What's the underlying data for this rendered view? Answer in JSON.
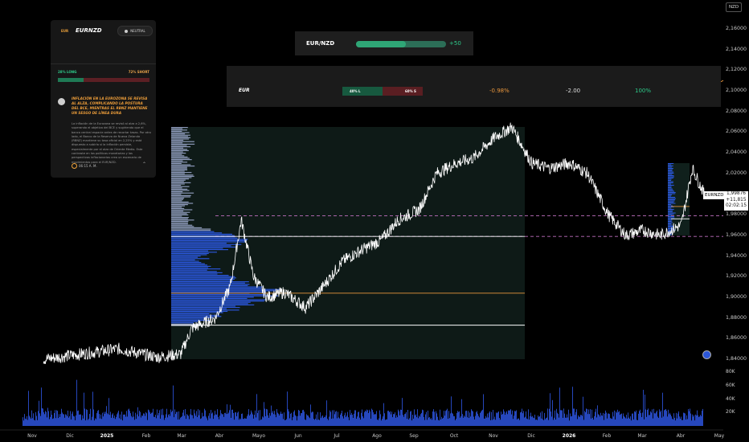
{
  "card": {
    "small_symbol": "EUR",
    "pair": "EURNZD",
    "sentiment": "NEUTRAL",
    "long_label": "28% LONG",
    "short_label": "72% SHORT",
    "long_fraction": 0.28,
    "headline": "INFLACIÓN EN LA EUROZONA SE REVISA AL ALZA, COMPLICANDO LA POSTURA DEL BCE, MIENTRAS EL RBNZ MANTIENE UN SESGO DE LÍNEA DURA",
    "body": "La inflación de la Eurozona se revisó al alza a 2,6%, superando el objetivo del BCE y sugiriendo que el banco central espacie antes de recortar tasas. Por otro lado, el Banco de la Reserva de Nueva Zelanda (RBNZ) mantiene su tasa oficial en 2,25% y está dispuesto a subirla si la inflación persiste, especialmente por el alza de Oriente Medio. Este contraste en las políticas monetarias y las perspectivas inflacionarias crea un escenario de movimientos para el EUR/NZD.",
    "time": "06:15 A. M."
  },
  "ticker": {
    "name": "EUR/NZD",
    "change": "+50",
    "fill_fraction": 0.55
  },
  "strip": {
    "symbol": "EUR",
    "long_pill": "40% L",
    "short_pill": "60% S",
    "pct_change": "-0.98%",
    "diff": "-2.00",
    "score": "100%"
  },
  "price_axis": {
    "currency": "NZD",
    "ticks": [
      "2,16000",
      "2,14000",
      "2,12000",
      "2,10000",
      "2,08000",
      "2,06000",
      "2,04000",
      "2,02000",
      "2,00000",
      "1,98000",
      "1,96000",
      "1,94000",
      "1,92000",
      "1,90000",
      "1,88000",
      "1,86000",
      "1,84000"
    ],
    "symbol_flag": "EURNZD",
    "last_price": "1,99876",
    "last_change": "+11,815",
    "countdown": "02:02:15"
  },
  "volume_axis": {
    "ticks": [
      "80K",
      "60K",
      "40K",
      "20K"
    ]
  },
  "time_axis": {
    "labels": [
      "Nov",
      "Dic",
      "2025",
      "Feb",
      "Mar",
      "Abr",
      "Mayo",
      "Jun",
      "Jul",
      "Ago",
      "Sep",
      "Oct",
      "Nov",
      "Dic",
      "2026",
      "Feb",
      "Mar",
      "Abr",
      "May"
    ],
    "bold": [
      "2025",
      "2026"
    ]
  },
  "colors": {
    "price_line": "#ffffff",
    "volume": "#2a4fd0",
    "profile_blue": "#2a56d8",
    "profile_grey": "#8a97b6",
    "orange_level": "#e8963d",
    "long_green": "#2ecb8b",
    "pink_dash": "#c070c0"
  },
  "chart_data": {
    "type": "line",
    "title": "EURNZD",
    "x_range": [
      "2024-11",
      "2026-05"
    ],
    "ylim": [
      1.84,
      2.16
    ],
    "series": [
      {
        "name": "EURNZD",
        "x": [
          "2024-11-01",
          "2024-12-01",
          "2025-01-01",
          "2025-02-01",
          "2025-02-20",
          "2025-03-01",
          "2025-03-20",
          "2025-04-01",
          "2025-04-10",
          "2025-04-20",
          "2025-05-01",
          "2025-05-15",
          "2025-06-01",
          "2025-06-15",
          "2025-07-01",
          "2025-07-15",
          "2025-08-01",
          "2025-08-15",
          "2025-09-01",
          "2025-09-15",
          "2025-10-01",
          "2025-10-15",
          "2025-11-01",
          "2025-11-15",
          "2025-12-01",
          "2025-12-15",
          "2026-01-01",
          "2026-01-15",
          "2026-02-01",
          "2026-02-15",
          "2026-03-01",
          "2026-03-15",
          "2026-04-01",
          "2026-04-10",
          "2026-04-20"
        ],
        "values": [
          1.84,
          1.845,
          1.85,
          1.842,
          1.845,
          1.87,
          1.88,
          1.91,
          1.975,
          1.92,
          1.9,
          1.905,
          1.89,
          1.91,
          1.935,
          1.945,
          1.955,
          1.975,
          1.985,
          2.02,
          2.03,
          2.035,
          2.055,
          2.065,
          2.03,
          2.025,
          2.03,
          2.02,
          1.98,
          1.96,
          1.965,
          1.96,
          1.97,
          2.025,
          1.999
        ]
      }
    ],
    "levels": [
      {
        "name": "orange",
        "value": 1.904
      },
      {
        "name": "white-upper",
        "value": 1.959
      },
      {
        "name": "white-lower",
        "value": 1.873
      },
      {
        "name": "pink-dash-upper",
        "value": 1.979
      },
      {
        "name": "pink-dash-lower",
        "value": 1.959
      }
    ],
    "volume": {
      "ylim": [
        0,
        90000
      ]
    },
    "grid": false,
    "legend": "none"
  }
}
